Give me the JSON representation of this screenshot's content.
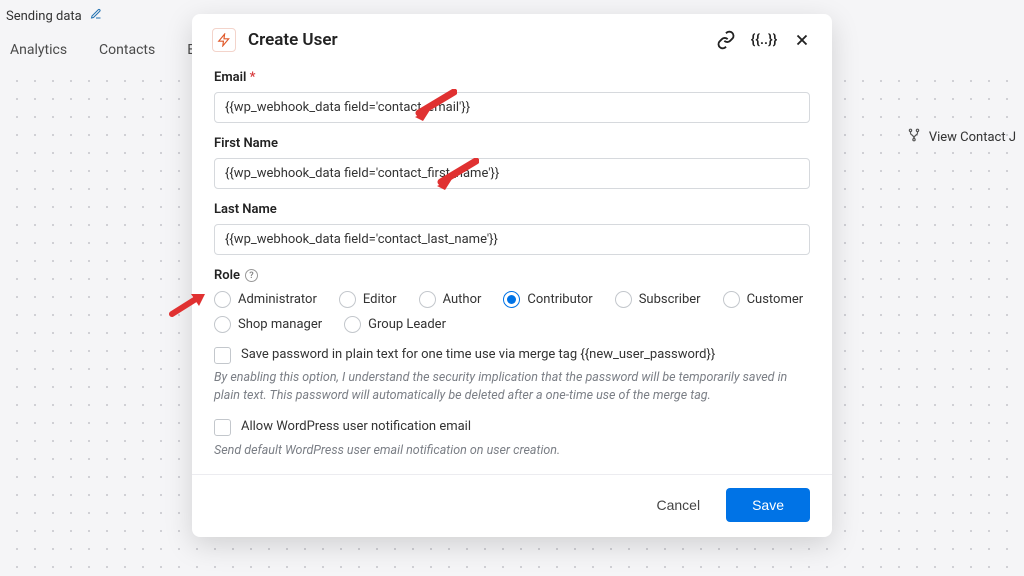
{
  "bg": {
    "sending": "Sending data",
    "tabs": [
      "Analytics",
      "Contacts",
      "E"
    ],
    "side_button": "View Contact J"
  },
  "modal": {
    "title": "Create User",
    "tools_brace": "{{..}}",
    "fields": {
      "email": {
        "label": "Email",
        "value": "{{wp_webhook_data field='contact_email'}}"
      },
      "first_name": {
        "label": "First Name",
        "value": "{{wp_webhook_data field='contact_first_name'}}"
      },
      "last_name": {
        "label": "Last Name",
        "value": "{{wp_webhook_data field='contact_last_name'}}"
      },
      "role": {
        "label": "Role",
        "selected": "Contributor",
        "options": [
          "Administrator",
          "Editor",
          "Author",
          "Contributor",
          "Subscriber",
          "Customer",
          "Shop manager",
          "Group Leader"
        ]
      }
    },
    "save_password": {
      "label": "Save password in plain text for one time use via merge tag {{new_user_password}}",
      "help": "By enabling this option, I understand the security implication that the password will be temporarily saved in plain text. This password will automatically be deleted after a one-time use of the merge tag."
    },
    "allow_notify": {
      "label": "Allow WordPress user notification email",
      "help": "Send default WordPress user email notification on user creation."
    },
    "buttons": {
      "cancel": "Cancel",
      "save": "Save"
    }
  }
}
